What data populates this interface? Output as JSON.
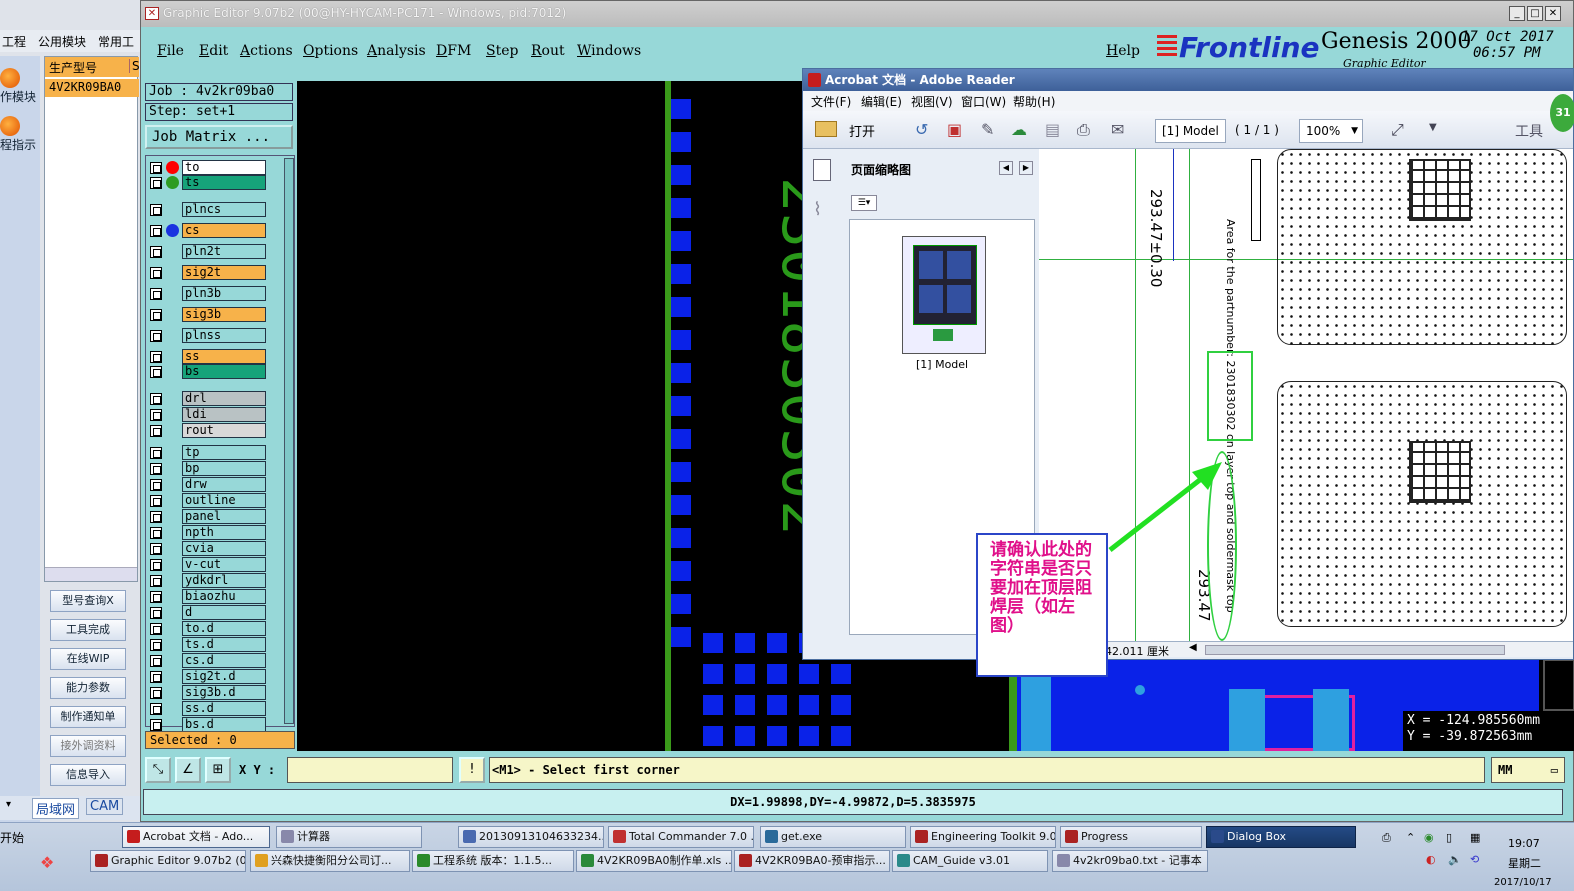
{
  "leftapp": {
    "menu": [
      "工程",
      "公用模块",
      "常用工"
    ],
    "side_buttons": [
      "作模块",
      "程指示"
    ],
    "grid_header": "生产型号",
    "grid_header2": "S",
    "grid_row": "4V2KR09BA0",
    "buttons": [
      "型号查询X",
      "工具完成",
      "在线WIP",
      "能力参数",
      "制作通知单",
      "接外调资料",
      "信息导入"
    ],
    "bottom_tabs": [
      "局域网",
      "CAM"
    ]
  },
  "ge": {
    "title": "Graphic Editor 9.07b2 (00@HY-HYCAM-PC171 - Windows, pid:7012)",
    "menu": [
      "File",
      "Edit",
      "Actions",
      "Options",
      "Analysis",
      "DFM",
      "Step",
      "Rout",
      "Windows"
    ],
    "help": "Help",
    "brand": "Frontline",
    "product": "Genesis 2000",
    "subtitle": "Graphic Editor",
    "date": "17 Oct 2017",
    "time": "06:57 PM",
    "job": "Job : 4v2kr09ba0",
    "step": "Step: set+1",
    "job_matrix": "Job Matrix ...",
    "layers": [
      {
        "name": "to",
        "color": "#ffffff",
        "dot": "#ff0000"
      },
      {
        "name": "ts",
        "color": "#16a37a",
        "dot": "#2e9c22"
      },
      {
        "name": "plncs",
        "color": "#97d8d8",
        "dot": ""
      },
      {
        "name": "cs",
        "color": "#f7b24a",
        "dot": "#1a33e0"
      },
      {
        "name": "pln2t",
        "color": "#97d8d8",
        "dot": ""
      },
      {
        "name": "sig2t",
        "color": "#f7b24a",
        "dot": ""
      },
      {
        "name": "pln3b",
        "color": "#97d8d8",
        "dot": ""
      },
      {
        "name": "sig3b",
        "color": "#f7b24a",
        "dot": ""
      },
      {
        "name": "plnss",
        "color": "#97d8d8",
        "dot": ""
      },
      {
        "name": "ss",
        "color": "#f7b24a",
        "dot": ""
      },
      {
        "name": "bs",
        "color": "#16a37a",
        "dot": ""
      },
      {
        "name": "drl",
        "color": "#b9c2c4",
        "dot": ""
      },
      {
        "name": "ldi",
        "color": "#b9c2c4",
        "dot": ""
      },
      {
        "name": "rout",
        "color": "#d8d8d8",
        "dot": ""
      },
      {
        "name": "tp",
        "color": "#97d8d8",
        "dot": ""
      },
      {
        "name": "bp",
        "color": "#97d8d8",
        "dot": ""
      },
      {
        "name": "drw",
        "color": "#97d8d8",
        "dot": ""
      },
      {
        "name": "outline",
        "color": "#97d8d8",
        "dot": ""
      },
      {
        "name": "panel",
        "color": "#97d8d8",
        "dot": ""
      },
      {
        "name": "npth",
        "color": "#97d8d8",
        "dot": ""
      },
      {
        "name": "cvia",
        "color": "#97d8d8",
        "dot": ""
      },
      {
        "name": "v-cut",
        "color": "#97d8d8",
        "dot": ""
      },
      {
        "name": "ydkdrl",
        "color": "#97d8d8",
        "dot": ""
      },
      {
        "name": "biaozhu",
        "color": "#97d8d8",
        "dot": ""
      },
      {
        "name": "d",
        "color": "#97d8d8",
        "dot": ""
      },
      {
        "name": "to.d",
        "color": "#97d8d8",
        "dot": ""
      },
      {
        "name": "ts.d",
        "color": "#97d8d8",
        "dot": ""
      },
      {
        "name": "cs.d",
        "color": "#97d8d8",
        "dot": ""
      },
      {
        "name": "sig2t.d",
        "color": "#97d8d8",
        "dot": ""
      },
      {
        "name": "sig3b.d",
        "color": "#97d8d8",
        "dot": ""
      },
      {
        "name": "ss.d",
        "color": "#97d8d8",
        "dot": ""
      },
      {
        "name": "bs.d",
        "color": "#97d8d8",
        "dot": ""
      }
    ],
    "selected": "Selected : 0",
    "canvas_text": "2301830302",
    "xy_label": "X Y :",
    "message": "<M1> - Select first corner",
    "units": "MM",
    "dx": "DX=1.99898,DY=-4.99872,D=5.3835975",
    "coord_x": "X = -124.985560mm",
    "coord_y": "Y = -39.872563mm"
  },
  "acrobat": {
    "title": "Acrobat 文档 - Adobe Reader",
    "menu": [
      "文件(F)",
      "编辑(E)",
      "视图(V)",
      "窗口(W)",
      "帮助(H)"
    ],
    "open": "打开",
    "page_label": "[1] Model",
    "page_count": "( 1 / 1 )",
    "zoom": "100%",
    "tools": "工具",
    "panel_title": "页面缩略图",
    "thumb_label": "[1] Model",
    "dim1": "293.47±0.30",
    "dim2": "293.47",
    "vertical_note": "Area for the partnumber: 2301830302 on layer top and soldermask top",
    "status": "42.011 厘米"
  },
  "callout": {
    "text": "请确认此处的字符串是否只要加在顶层阻焊层（如左图）"
  },
  "taskbar": {
    "start": "开始",
    "row1": [
      "Acrobat 文档 - Ado...",
      "计算器",
      "20130913104633234....",
      "Total Commander 7.0 ...",
      "get.exe",
      "Engineering Toolkit 9.0...",
      "Progress",
      "Dialog Box"
    ],
    "row2": [
      "Graphic Editor 9.07b2 (0...",
      "兴森快捷衡阳分公司订...",
      "工程系统  版本：1.1.5...",
      "4V2KR09BA0制作单.xls ...",
      "4V2KR09BA0-预审指示...",
      "CAM_Guide v3.01",
      "4v2kr09ba0.txt - 记事本"
    ],
    "clock_time": "19:07",
    "clock_day": "星期二",
    "clock_date": "2017/10/17",
    "badge": "31"
  }
}
